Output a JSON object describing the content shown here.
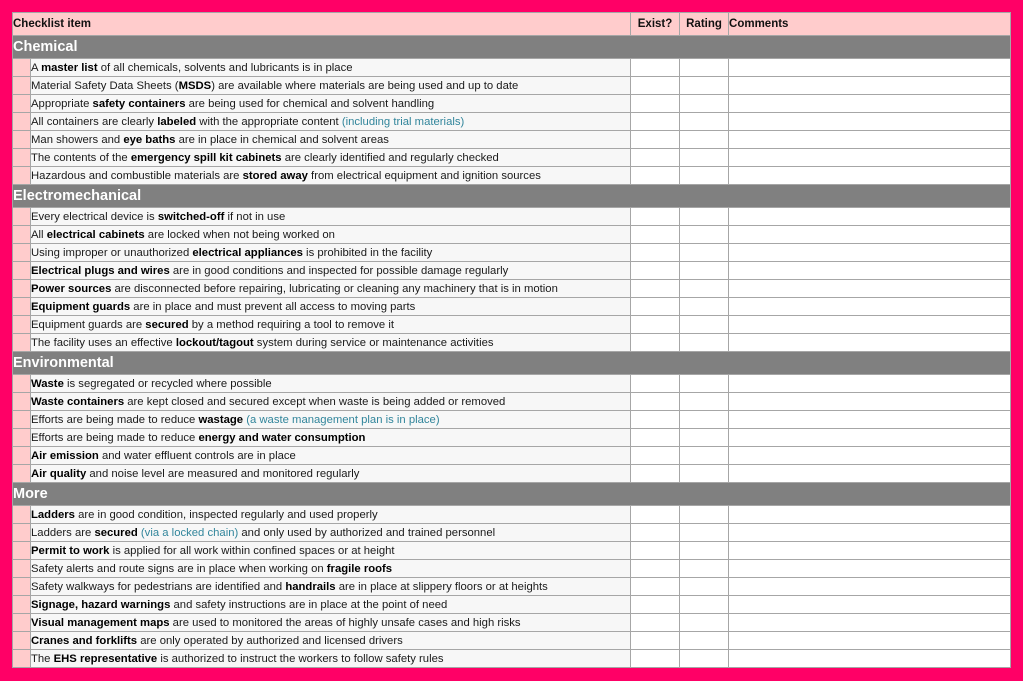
{
  "colors": {
    "frame": "#FF0066",
    "header_bg": "#FFCCCC",
    "section_bg": "#808080",
    "indicator_bg": "#FFCCCC",
    "note_text": "#31859B"
  },
  "header": {
    "item": "Checklist item",
    "exist": "Exist?",
    "rating": "Rating",
    "comments": "Comments"
  },
  "sections": [
    {
      "title": "Chemical",
      "items": [
        [
          {
            "t": "A "
          },
          {
            "t": "master list",
            "b": true
          },
          {
            "t": " of all chemicals, solvents and lubricants is in place"
          }
        ],
        [
          {
            "t": "Material Safety Data Sheets ("
          },
          {
            "t": "MSDS",
            "b": true
          },
          {
            "t": ") are available where materials are being used and up to date"
          }
        ],
        [
          {
            "t": "Appropriate "
          },
          {
            "t": "safety containers",
            "b": true
          },
          {
            "t": " are being used for chemical and solvent handling"
          }
        ],
        [
          {
            "t": "All containers are clearly "
          },
          {
            "t": "labeled",
            "b": true
          },
          {
            "t": " with the appropriate content "
          },
          {
            "t": "(including trial materials)",
            "n": true
          }
        ],
        [
          {
            "t": "Man showers and "
          },
          {
            "t": "eye baths",
            "b": true
          },
          {
            "t": " are in place in chemical and solvent areas"
          }
        ],
        [
          {
            "t": "The contents of the "
          },
          {
            "t": "emergency spill kit cabinets",
            "b": true
          },
          {
            "t": " are clearly identified and regularly checked"
          }
        ],
        [
          {
            "t": "Hazardous and combustible materials are "
          },
          {
            "t": "stored away",
            "b": true
          },
          {
            "t": " from electrical equipment and ignition sources"
          }
        ]
      ]
    },
    {
      "title": "Electromechanical",
      "items": [
        [
          {
            "t": "Every electrical device is "
          },
          {
            "t": "switched-off",
            "b": true
          },
          {
            "t": " if not in use"
          }
        ],
        [
          {
            "t": "All "
          },
          {
            "t": "electrical cabinets",
            "b": true
          },
          {
            "t": " are locked when not being worked on"
          }
        ],
        [
          {
            "t": "Using improper or unauthorized "
          },
          {
            "t": "electrical appliances",
            "b": true
          },
          {
            "t": " is prohibited in the facility"
          }
        ],
        [
          {
            "t": "Electrical plugs and wires",
            "b": true
          },
          {
            "t": " are in good conditions and inspected for possible damage regularly"
          }
        ],
        [
          {
            "t": "Power sources",
            "b": true
          },
          {
            "t": " are disconnected before repairing, lubricating or cleaning any machinery that is in motion"
          }
        ],
        [
          {
            "t": "Equipment guards",
            "b": true
          },
          {
            "t": " are in place and must prevent all access to moving parts"
          }
        ],
        [
          {
            "t": "Equipment guards are "
          },
          {
            "t": "secured",
            "b": true
          },
          {
            "t": " by a method requiring a tool to remove it"
          }
        ],
        [
          {
            "t": "The facility uses an effective "
          },
          {
            "t": "lockout/tagout",
            "b": true
          },
          {
            "t": " system during service or maintenance activities"
          }
        ]
      ]
    },
    {
      "title": "Environmental",
      "items": [
        [
          {
            "t": "Waste",
            "b": true
          },
          {
            "t": " is segregated or recycled where possible"
          }
        ],
        [
          {
            "t": "Waste containers",
            "b": true
          },
          {
            "t": " are kept closed and secured except when waste is being added or removed"
          }
        ],
        [
          {
            "t": "Efforts are being made to reduce  "
          },
          {
            "t": "wastage",
            "b": true
          },
          {
            "t": " "
          },
          {
            "t": "(a waste management plan is in place)",
            "n": true
          }
        ],
        [
          {
            "t": "Efforts are being made to reduce "
          },
          {
            "t": "energy and water consumption",
            "b": true
          }
        ],
        [
          {
            "t": "Air emission",
            "b": true
          },
          {
            "t": " and water effluent controls are in place"
          }
        ],
        [
          {
            "t": "Air quality",
            "b": true
          },
          {
            "t": " and noise level are measured and monitored regularly"
          }
        ]
      ]
    },
    {
      "title": "More",
      "items": [
        [
          {
            "t": "Ladders",
            "b": true
          },
          {
            "t": " are in good condition, inspected regularly and used properly"
          }
        ],
        [
          {
            "t": "Ladders are "
          },
          {
            "t": "secured",
            "b": true
          },
          {
            "t": " "
          },
          {
            "t": "(via a locked chain)",
            "n": true
          },
          {
            "t": " and only used by authorized and trained personnel"
          }
        ],
        [
          {
            "t": "Permit to work",
            "b": true
          },
          {
            "t": " is applied for all work within confined spaces or at height"
          }
        ],
        [
          {
            "t": "Safety alerts and route signs are in place when working on "
          },
          {
            "t": "fragile roofs",
            "b": true
          }
        ],
        [
          {
            "t": "Safety walkways for pedestrians are identified and "
          },
          {
            "t": "handrails",
            "b": true
          },
          {
            "t": " are in place at slippery floors or at heights"
          }
        ],
        [
          {
            "t": "Signage, hazard warnings",
            "b": true
          },
          {
            "t": " and safety instructions are in place at the point of need"
          }
        ],
        [
          {
            "t": "Visual management maps",
            "b": true
          },
          {
            "t": " are used to monitored the areas of highly unsafe cases and high risks"
          }
        ],
        [
          {
            "t": "Cranes and forklifts",
            "b": true
          },
          {
            "t": " are only operated by authorized and licensed drivers"
          }
        ],
        [
          {
            "t": "The "
          },
          {
            "t": "EHS representative",
            "b": true
          },
          {
            "t": " is authorized to instruct the workers to follow safety rules"
          }
        ]
      ]
    }
  ]
}
